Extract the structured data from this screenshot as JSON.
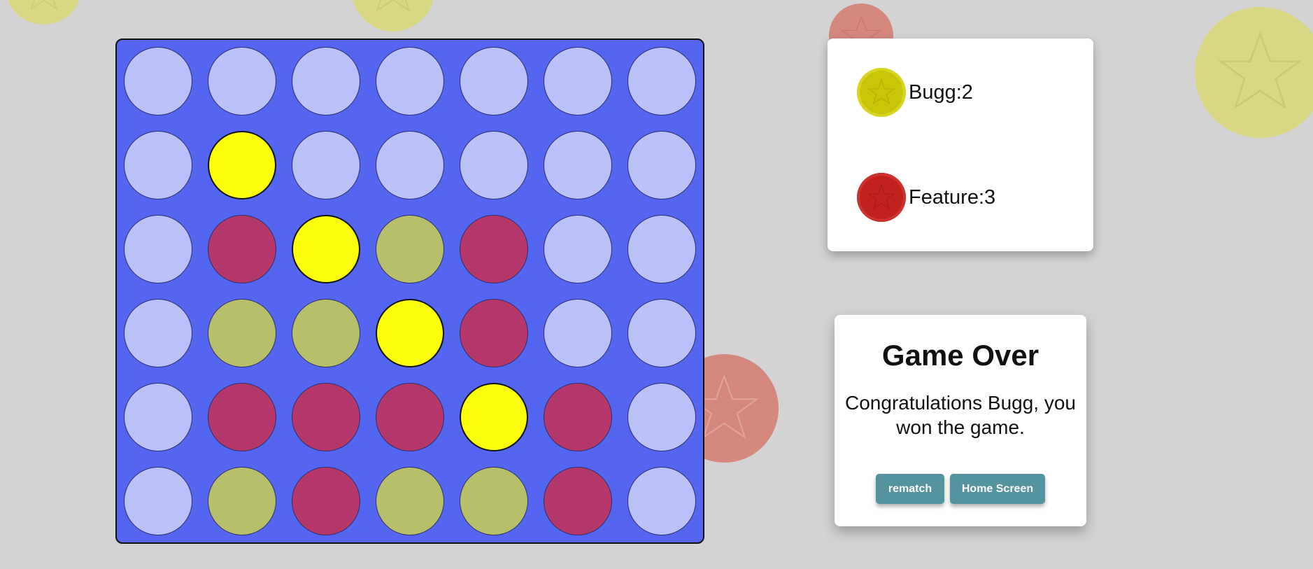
{
  "board": {
    "rows": [
      [
        "empty",
        "empty",
        "empty",
        "empty",
        "empty",
        "empty",
        "empty"
      ],
      [
        "empty",
        "win",
        "empty",
        "empty",
        "empty",
        "empty",
        "empty"
      ],
      [
        "empty",
        "red",
        "win",
        "olive",
        "red",
        "empty",
        "empty"
      ],
      [
        "empty",
        "olive",
        "olive",
        "win",
        "red",
        "empty",
        "empty"
      ],
      [
        "empty",
        "red",
        "red",
        "red",
        "win",
        "red",
        "empty"
      ],
      [
        "empty",
        "olive",
        "red",
        "olive",
        "olive",
        "red",
        "empty"
      ]
    ]
  },
  "scores": {
    "player1": {
      "label": "Bugg:2",
      "coin": "yellow-star-coin"
    },
    "player2": {
      "label": "Feature:3",
      "coin": "red-star-coin"
    }
  },
  "game_over": {
    "title": "Game Over",
    "message": "Congratulations Bugg, you won the game.",
    "rematch_label": "rematch",
    "home_label": "Home Screen"
  },
  "colors": {
    "board": "#5465ef",
    "empty": "#b9c1f8",
    "red_piece": "#b6386a",
    "olive_piece": "#b8bf6a",
    "winning_piece": "#fafd0c",
    "button": "#55939f"
  }
}
